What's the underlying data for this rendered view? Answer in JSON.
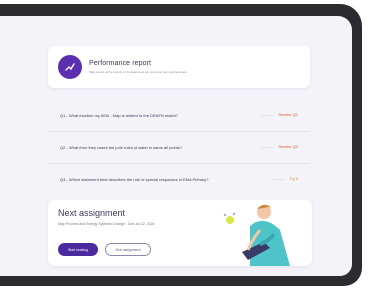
{
  "report": {
    "title": "Performance report",
    "subtitle": "Take a look at the results of the latest test you took and your performance"
  },
  "questions": [
    {
      "text": "Q1 - What function my 60W - Map is related to the DRAFN match?",
      "dash": "————",
      "status": "Review Q1",
      "status_color": "#e5533a"
    },
    {
      "text": "Q2 - What from they cases the pole rules of water is same all points?",
      "dash": "————",
      "status": "Review Q2",
      "status_color": "#e5533a"
    },
    {
      "text": "Q3 - Which statement best describes the role of special responses in EMA Primary?",
      "dash": "————",
      "status": "Try it",
      "status_color": "#e58a3a"
    }
  ],
  "assignment": {
    "title": "Next assignment",
    "subtitle": "Map Process and Energy Systems Change - Due Jul 22, 2024",
    "primary_label": "Start reading",
    "secondary_label": "See assignment"
  },
  "colors": {
    "accent": "#4b2a9e",
    "avatar": "#5c2fb0",
    "error": "#e5533a",
    "warning": "#e58a3a"
  },
  "icons": {
    "report_avatar": "chart-icon"
  }
}
